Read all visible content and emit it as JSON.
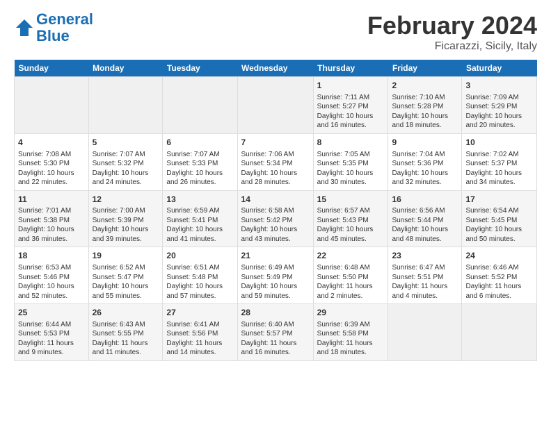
{
  "header": {
    "logo_line1": "General",
    "logo_line2": "Blue",
    "title": "February 2024",
    "subtitle": "Ficarazzi, Sicily, Italy"
  },
  "columns": [
    "Sunday",
    "Monday",
    "Tuesday",
    "Wednesday",
    "Thursday",
    "Friday",
    "Saturday"
  ],
  "weeks": [
    [
      {
        "day": "",
        "info": ""
      },
      {
        "day": "",
        "info": ""
      },
      {
        "day": "",
        "info": ""
      },
      {
        "day": "",
        "info": ""
      },
      {
        "day": "1",
        "info": "Sunrise: 7:11 AM\nSunset: 5:27 PM\nDaylight: 10 hours\nand 16 minutes."
      },
      {
        "day": "2",
        "info": "Sunrise: 7:10 AM\nSunset: 5:28 PM\nDaylight: 10 hours\nand 18 minutes."
      },
      {
        "day": "3",
        "info": "Sunrise: 7:09 AM\nSunset: 5:29 PM\nDaylight: 10 hours\nand 20 minutes."
      }
    ],
    [
      {
        "day": "4",
        "info": "Sunrise: 7:08 AM\nSunset: 5:30 PM\nDaylight: 10 hours\nand 22 minutes."
      },
      {
        "day": "5",
        "info": "Sunrise: 7:07 AM\nSunset: 5:32 PM\nDaylight: 10 hours\nand 24 minutes."
      },
      {
        "day": "6",
        "info": "Sunrise: 7:07 AM\nSunset: 5:33 PM\nDaylight: 10 hours\nand 26 minutes."
      },
      {
        "day": "7",
        "info": "Sunrise: 7:06 AM\nSunset: 5:34 PM\nDaylight: 10 hours\nand 28 minutes."
      },
      {
        "day": "8",
        "info": "Sunrise: 7:05 AM\nSunset: 5:35 PM\nDaylight: 10 hours\nand 30 minutes."
      },
      {
        "day": "9",
        "info": "Sunrise: 7:04 AM\nSunset: 5:36 PM\nDaylight: 10 hours\nand 32 minutes."
      },
      {
        "day": "10",
        "info": "Sunrise: 7:02 AM\nSunset: 5:37 PM\nDaylight: 10 hours\nand 34 minutes."
      }
    ],
    [
      {
        "day": "11",
        "info": "Sunrise: 7:01 AM\nSunset: 5:38 PM\nDaylight: 10 hours\nand 36 minutes."
      },
      {
        "day": "12",
        "info": "Sunrise: 7:00 AM\nSunset: 5:39 PM\nDaylight: 10 hours\nand 39 minutes."
      },
      {
        "day": "13",
        "info": "Sunrise: 6:59 AM\nSunset: 5:41 PM\nDaylight: 10 hours\nand 41 minutes."
      },
      {
        "day": "14",
        "info": "Sunrise: 6:58 AM\nSunset: 5:42 PM\nDaylight: 10 hours\nand 43 minutes."
      },
      {
        "day": "15",
        "info": "Sunrise: 6:57 AM\nSunset: 5:43 PM\nDaylight: 10 hours\nand 45 minutes."
      },
      {
        "day": "16",
        "info": "Sunrise: 6:56 AM\nSunset: 5:44 PM\nDaylight: 10 hours\nand 48 minutes."
      },
      {
        "day": "17",
        "info": "Sunrise: 6:54 AM\nSunset: 5:45 PM\nDaylight: 10 hours\nand 50 minutes."
      }
    ],
    [
      {
        "day": "18",
        "info": "Sunrise: 6:53 AM\nSunset: 5:46 PM\nDaylight: 10 hours\nand 52 minutes."
      },
      {
        "day": "19",
        "info": "Sunrise: 6:52 AM\nSunset: 5:47 PM\nDaylight: 10 hours\nand 55 minutes."
      },
      {
        "day": "20",
        "info": "Sunrise: 6:51 AM\nSunset: 5:48 PM\nDaylight: 10 hours\nand 57 minutes."
      },
      {
        "day": "21",
        "info": "Sunrise: 6:49 AM\nSunset: 5:49 PM\nDaylight: 10 hours\nand 59 minutes."
      },
      {
        "day": "22",
        "info": "Sunrise: 6:48 AM\nSunset: 5:50 PM\nDaylight: 11 hours\nand 2 minutes."
      },
      {
        "day": "23",
        "info": "Sunrise: 6:47 AM\nSunset: 5:51 PM\nDaylight: 11 hours\nand 4 minutes."
      },
      {
        "day": "24",
        "info": "Sunrise: 6:46 AM\nSunset: 5:52 PM\nDaylight: 11 hours\nand 6 minutes."
      }
    ],
    [
      {
        "day": "25",
        "info": "Sunrise: 6:44 AM\nSunset: 5:53 PM\nDaylight: 11 hours\nand 9 minutes."
      },
      {
        "day": "26",
        "info": "Sunrise: 6:43 AM\nSunset: 5:55 PM\nDaylight: 11 hours\nand 11 minutes."
      },
      {
        "day": "27",
        "info": "Sunrise: 6:41 AM\nSunset: 5:56 PM\nDaylight: 11 hours\nand 14 minutes."
      },
      {
        "day": "28",
        "info": "Sunrise: 6:40 AM\nSunset: 5:57 PM\nDaylight: 11 hours\nand 16 minutes."
      },
      {
        "day": "29",
        "info": "Sunrise: 6:39 AM\nSunset: 5:58 PM\nDaylight: 11 hours\nand 18 minutes."
      },
      {
        "day": "",
        "info": ""
      },
      {
        "day": "",
        "info": ""
      }
    ]
  ]
}
